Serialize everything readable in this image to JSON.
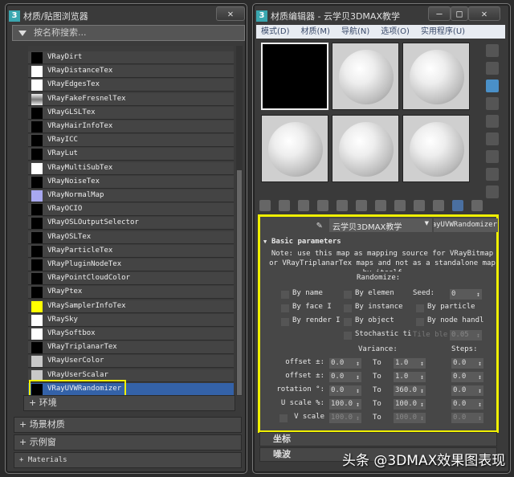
{
  "browser": {
    "title": "材质/贴图浏览器",
    "close": "✕",
    "search_placeholder": "按名称搜索...",
    "items": [
      {
        "label": "VRayDirt",
        "swatch": "#000000"
      },
      {
        "label": "VRayDistanceTex",
        "swatch": "#ffffff"
      },
      {
        "label": "VRayEdgesTex",
        "swatch": "#ffffff"
      },
      {
        "label": "VRayFakeFresnelTex",
        "swatch": "linear-gradient(#eee,#777,#eee)"
      },
      {
        "label": "VRayGLSLTex",
        "swatch": "#000000"
      },
      {
        "label": "VRayHairInfoTex",
        "swatch": "#000000"
      },
      {
        "label": "VRayICC",
        "swatch": "#000000"
      },
      {
        "label": "VRayLut",
        "swatch": "#000000"
      },
      {
        "label": "VRayMultiSubTex",
        "swatch": "#ffffff"
      },
      {
        "label": "VRayNoiseTex",
        "swatch": "#000000"
      },
      {
        "label": "VRayNormalMap",
        "swatch": "#a8a8f0"
      },
      {
        "label": "VRayOCIO",
        "swatch": "#000000"
      },
      {
        "label": "VRayOSLOutputSelector",
        "swatch": "#000000"
      },
      {
        "label": "VRayOSLTex",
        "swatch": "#000000"
      },
      {
        "label": "VRayParticleTex",
        "swatch": "#000000"
      },
      {
        "label": "VRayPluginNodeTex",
        "swatch": "#000000"
      },
      {
        "label": "VRayPointCloudColor",
        "swatch": "#000000"
      },
      {
        "label": "VRayPtex",
        "swatch": "#000000"
      },
      {
        "label": "VRaySamplerInfoTex",
        "swatch": "#ffff00"
      },
      {
        "label": "VRaySky",
        "swatch": "#ffffff"
      },
      {
        "label": "VRaySoftbox",
        "swatch": "#ffffff"
      },
      {
        "label": "VRayTriplanarTex",
        "swatch": "#000000"
      },
      {
        "label": "VRayUserColor",
        "swatch": "#c8c8c8"
      },
      {
        "label": "VRayUserScalar",
        "swatch": "#c8c8c8"
      },
      {
        "label": "VRayUVWRandomizer",
        "swatch": "#000000",
        "selected": true
      }
    ],
    "subgroup": "+ 环境",
    "groups": [
      "+ 场景材质",
      "+ 示例窗",
      "+ Materials"
    ]
  },
  "editor": {
    "title": "材质编辑器 - 云学贝3DMAX教学",
    "min": "—",
    "max": "□",
    "close": "✕",
    "menu": [
      "模式(D)",
      "材质(M)",
      "导航(N)",
      "选项(O)",
      "实用程序(U)"
    ],
    "material_name": "云学贝3DMAX教学",
    "map_type": "VRayUVWRandomizer",
    "rollout_title": "Basic parameters",
    "note": "Note: use this map as mapping source for VRayBitmap or VRayTriplanarTex maps and not as a standalone map by itself",
    "randomize_label": "Randomize:",
    "checks": [
      "By name",
      "By elemen",
      "By face I",
      "By instance",
      "By render I",
      "By object",
      "Stochastic ti",
      "By particle",
      "By node handl"
    ],
    "seed_label": "Seed:",
    "seed": "0",
    "tile_label": "Tile ble",
    "tile": "0.05",
    "variance_label": "Variance:",
    "steps_label": "Steps:",
    "to": "To",
    "rows": [
      {
        "label": "offset ±:",
        "from": "0.0",
        "to": "1.0",
        "steps": "0.0"
      },
      {
        "label": "offset ±:",
        "from": "0.0",
        "to": "1.0",
        "steps": "0.0"
      },
      {
        "label": "rotation °:",
        "from": "0.0",
        "to": "360.0",
        "steps": "0.0"
      },
      {
        "label": "U scale %:",
        "from": "100.0",
        "to": "100.0",
        "steps": "0.0"
      },
      {
        "label": "V scale",
        "from": "100.0",
        "to": "100.0",
        "steps": "0.0"
      }
    ],
    "rollouts": [
      "坐标",
      "噪波"
    ]
  },
  "watermark": "头条 @3DMAX效果图表现"
}
